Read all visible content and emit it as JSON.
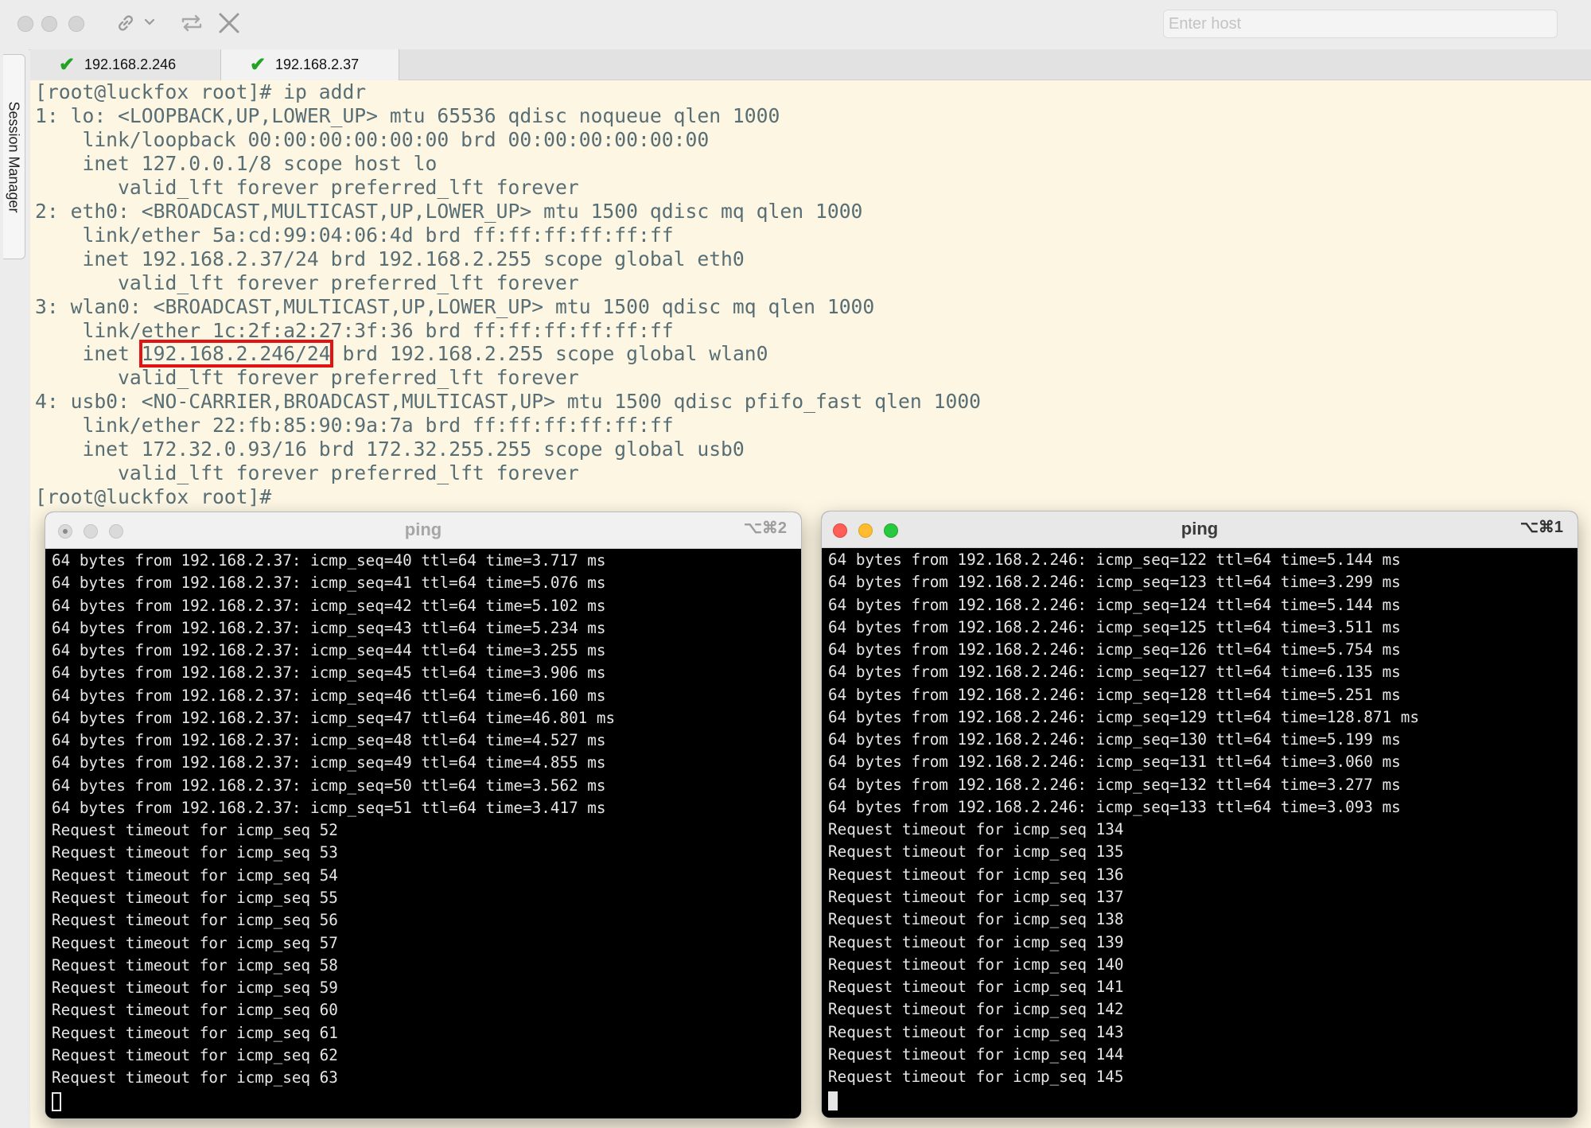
{
  "toolbar": {
    "host_placeholder": "Enter host",
    "icons": [
      "link-icon",
      "chevron-down-icon",
      "reconnect-icon",
      "close-icon"
    ]
  },
  "sidebar": {
    "label": "Session Manager"
  },
  "tabs": [
    {
      "label": "192.168.2.246",
      "status": "connected",
      "status_color": "#23a323"
    },
    {
      "label": "192.168.2.37",
      "status": "connected",
      "status_color": "#23a323"
    }
  ],
  "main_terminal": {
    "background": "#fdf6e3",
    "text_color": "#586e75",
    "highlight_color": "#e01414",
    "lines": [
      "[root@luckfox root]# ip addr",
      "1: lo: <LOOPBACK,UP,LOWER_UP> mtu 65536 qdisc noqueue qlen 1000",
      "    link/loopback 00:00:00:00:00:00 brd 00:00:00:00:00:00",
      "    inet 127.0.0.1/8 scope host lo",
      "       valid_lft forever preferred_lft forever",
      "2: eth0: <BROADCAST,MULTICAST,UP,LOWER_UP> mtu 1500 qdisc mq qlen 1000",
      "    link/ether 5a:cd:99:04:06:4d brd ff:ff:ff:ff:ff:ff",
      "    inet 192.168.2.37/24 brd 192.168.2.255 scope global eth0",
      "       valid_lft forever preferred_lft forever",
      "3: wlan0: <BROADCAST,MULTICAST,UP,LOWER_UP> mtu 1500 qdisc mq qlen 1000",
      "    link/ether 1c:2f:a2:27:3f:36 brd ff:ff:ff:ff:ff:ff"
    ],
    "highlight_line": {
      "prefix": "    inet ",
      "highlighted": "192.168.2.246/24",
      "suffix": " brd 192.168.2.255 scope global wlan0"
    },
    "lines_after": [
      "       valid_lft forever preferred_lft forever",
      "4: usb0: <NO-CARRIER,BROADCAST,MULTICAST,UP> mtu 1500 qdisc pfifo_fast qlen 1000",
      "    link/ether 22:fb:85:90:9a:7a brd ff:ff:ff:ff:ff:ff",
      "    inet 172.32.0.93/16 brd 172.32.255.255 scope global usb0",
      "       valid_lft forever preferred_lft forever",
      "[root@luckfox root]#"
    ]
  },
  "ping_windows": [
    {
      "title": "ping",
      "shortcut": "⌥⌘2",
      "active": false,
      "lines": [
        "64 bytes from 192.168.2.37: icmp_seq=40 ttl=64 time=3.717 ms",
        "64 bytes from 192.168.2.37: icmp_seq=41 ttl=64 time=5.076 ms",
        "64 bytes from 192.168.2.37: icmp_seq=42 ttl=64 time=5.102 ms",
        "64 bytes from 192.168.2.37: icmp_seq=43 ttl=64 time=5.234 ms",
        "64 bytes from 192.168.2.37: icmp_seq=44 ttl=64 time=3.255 ms",
        "64 bytes from 192.168.2.37: icmp_seq=45 ttl=64 time=3.906 ms",
        "64 bytes from 192.168.2.37: icmp_seq=46 ttl=64 time=6.160 ms",
        "64 bytes from 192.168.2.37: icmp_seq=47 ttl=64 time=46.801 ms",
        "64 bytes from 192.168.2.37: icmp_seq=48 ttl=64 time=4.527 ms",
        "64 bytes from 192.168.2.37: icmp_seq=49 ttl=64 time=4.855 ms",
        "64 bytes from 192.168.2.37: icmp_seq=50 ttl=64 time=3.562 ms",
        "64 bytes from 192.168.2.37: icmp_seq=51 ttl=64 time=3.417 ms",
        "Request timeout for icmp_seq 52",
        "Request timeout for icmp_seq 53",
        "Request timeout for icmp_seq 54",
        "Request timeout for icmp_seq 55",
        "Request timeout for icmp_seq 56",
        "Request timeout for icmp_seq 57",
        "Request timeout for icmp_seq 58",
        "Request timeout for icmp_seq 59",
        "Request timeout for icmp_seq 60",
        "Request timeout for icmp_seq 61",
        "Request timeout for icmp_seq 62",
        "Request timeout for icmp_seq 63"
      ]
    },
    {
      "title": "ping",
      "shortcut": "⌥⌘1",
      "active": true,
      "lines": [
        "64 bytes from 192.168.2.246: icmp_seq=122 ttl=64 time=5.144 ms",
        "64 bytes from 192.168.2.246: icmp_seq=123 ttl=64 time=3.299 ms",
        "64 bytes from 192.168.2.246: icmp_seq=124 ttl=64 time=5.144 ms",
        "64 bytes from 192.168.2.246: icmp_seq=125 ttl=64 time=3.511 ms",
        "64 bytes from 192.168.2.246: icmp_seq=126 ttl=64 time=5.754 ms",
        "64 bytes from 192.168.2.246: icmp_seq=127 ttl=64 time=6.135 ms",
        "64 bytes from 192.168.2.246: icmp_seq=128 ttl=64 time=5.251 ms",
        "64 bytes from 192.168.2.246: icmp_seq=129 ttl=64 time=128.871 ms",
        "64 bytes from 192.168.2.246: icmp_seq=130 ttl=64 time=5.199 ms",
        "64 bytes from 192.168.2.246: icmp_seq=131 ttl=64 time=3.060 ms",
        "64 bytes from 192.168.2.246: icmp_seq=132 ttl=64 time=3.277 ms",
        "64 bytes from 192.168.2.246: icmp_seq=133 ttl=64 time=3.093 ms",
        "Request timeout for icmp_seq 134",
        "Request timeout for icmp_seq 135",
        "Request timeout for icmp_seq 136",
        "Request timeout for icmp_seq 137",
        "Request timeout for icmp_seq 138",
        "Request timeout for icmp_seq 139",
        "Request timeout for icmp_seq 140",
        "Request timeout for icmp_seq 141",
        "Request timeout for icmp_seq 142",
        "Request timeout for icmp_seq 143",
        "Request timeout for icmp_seq 144",
        "Request timeout for icmp_seq 145"
      ]
    }
  ]
}
